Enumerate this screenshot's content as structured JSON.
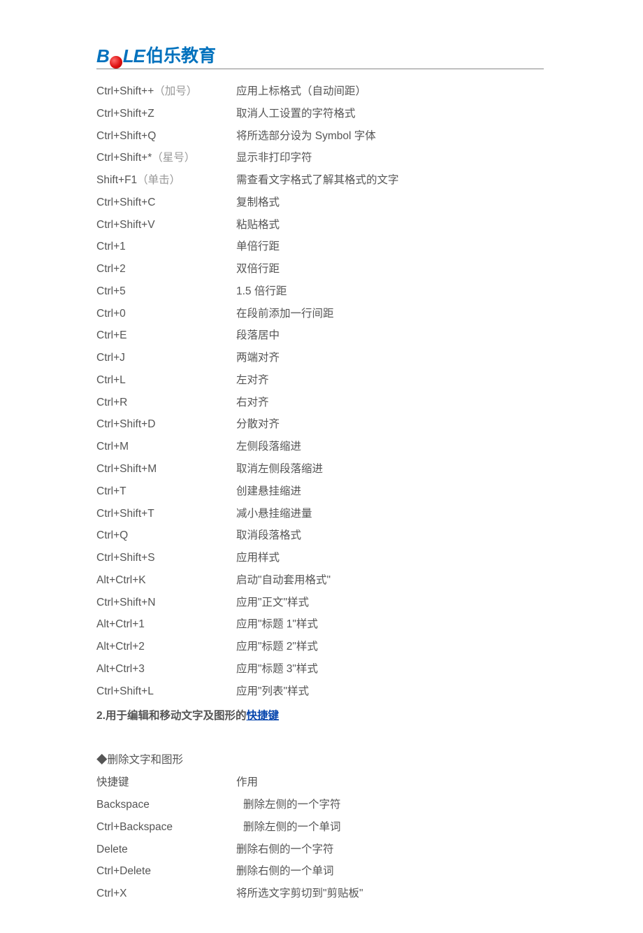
{
  "logo": {
    "b": "B",
    "le": "LE",
    "cn": "伯乐教育"
  },
  "shortcuts1": [
    {
      "key": "Ctrl+Shift++",
      "paren": "（加号）",
      "desc": "应用上标格式（自动间距）"
    },
    {
      "key": "Ctrl+Shift+Z",
      "paren": "",
      "desc": "取消人工设置的字符格式"
    },
    {
      "key": "Ctrl+Shift+Q",
      "paren": "",
      "desc": "将所选部分设为 Symbol 字体"
    },
    {
      "key": "Ctrl+Shift+*",
      "paren": "（星号）",
      "desc": "显示非打印字符"
    },
    {
      "key": "Shift+F1",
      "paren": "（单击）",
      "desc": "需查看文字格式了解其格式的文字"
    },
    {
      "key": "Ctrl+Shift+C",
      "paren": "",
      "desc": "复制格式"
    },
    {
      "key": "Ctrl+Shift+V",
      "paren": "",
      "desc": "粘贴格式"
    },
    {
      "key": "Ctrl+1",
      "paren": "",
      "desc": "单倍行距"
    },
    {
      "key": "Ctrl+2",
      "paren": "",
      "desc": "双倍行距"
    },
    {
      "key": "Ctrl+5",
      "paren": "",
      "desc": "1.5 倍行距"
    },
    {
      "key": "Ctrl+0",
      "paren": "",
      "desc": "在段前添加一行间距"
    },
    {
      "key": "Ctrl+E",
      "paren": "",
      "desc": "段落居中"
    },
    {
      "key": "Ctrl+J",
      "paren": "",
      "desc": "两端对齐"
    },
    {
      "key": "Ctrl+L",
      "paren": "",
      "desc": "左对齐"
    },
    {
      "key": "Ctrl+R",
      "paren": "",
      "desc": "右对齐"
    },
    {
      "key": "Ctrl+Shift+D",
      "paren": "",
      "desc": "分散对齐"
    },
    {
      "key": "Ctrl+M",
      "paren": "",
      "desc": "左侧段落缩进"
    },
    {
      "key": "Ctrl+Shift+M",
      "paren": "",
      "desc": "取消左侧段落缩进"
    },
    {
      "key": "Ctrl+T",
      "paren": "",
      "desc": "创建悬挂缩进"
    },
    {
      "key": "Ctrl+Shift+T",
      "paren": "",
      "desc": "减小悬挂缩进量"
    },
    {
      "key": "Ctrl+Q",
      "paren": "",
      "desc": "取消段落格式"
    },
    {
      "key": "Ctrl+Shift+S",
      "paren": "",
      "desc": "应用样式"
    },
    {
      "key": "Alt+Ctrl+K",
      "paren": "",
      "desc": "启动\"自动套用格式\""
    },
    {
      "key": "Ctrl+Shift+N",
      "paren": "",
      "desc": "应用\"正文\"样式"
    },
    {
      "key": "Alt+Ctrl+1",
      "paren": "",
      "desc": "应用\"标题 1\"样式"
    },
    {
      "key": "Alt+Ctrl+2",
      "paren": "",
      "desc": "应用\"标题 2\"样式"
    },
    {
      "key": "Alt+Ctrl+3",
      "paren": "",
      "desc": "应用\"标题 3\"样式"
    },
    {
      "key": "Ctrl+Shift+L",
      "paren": "",
      "desc": "应用\"列表\"样式"
    }
  ],
  "section2": {
    "num": "2.",
    "plain": "用于编辑和移动文字及图形的",
    "link": "快捷键"
  },
  "subhead2": "◆删除文字和图形",
  "tableHeader2": {
    "key": "快捷键",
    "desc": "作用"
  },
  "shortcuts2": [
    {
      "key": "Backspace",
      "desc": "删除左侧的一个字符",
      "indent": true
    },
    {
      "key": "Ctrl+Backspace",
      "desc": "删除左侧的一个单词",
      "indent": true
    },
    {
      "key": "Delete",
      "desc": "删除右侧的一个字符",
      "indent": false
    },
    {
      "key": "Ctrl+Delete",
      "desc": "删除右侧的一个单词",
      "indent": false
    },
    {
      "key": "Ctrl+X",
      "desc": "将所选文字剪切到\"剪贴板\"",
      "indent": false
    }
  ]
}
